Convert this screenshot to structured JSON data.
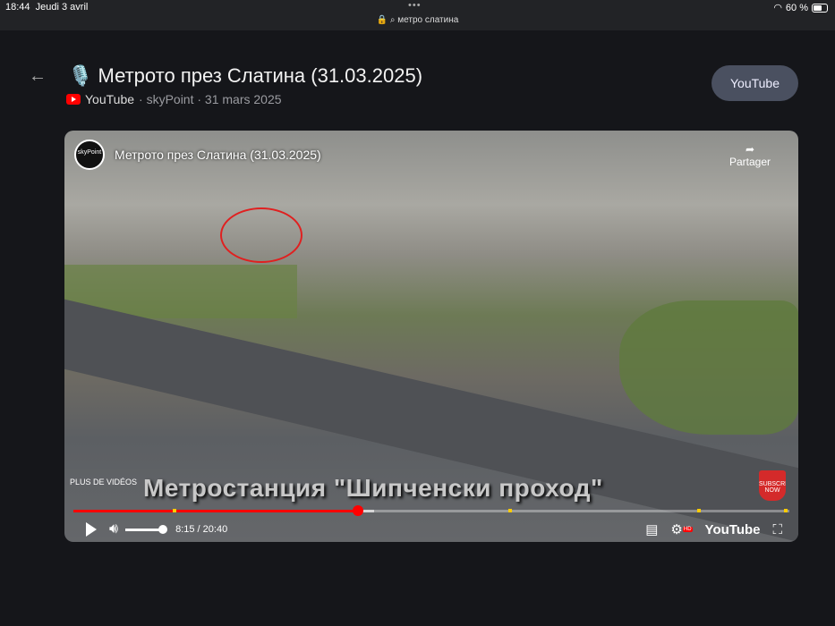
{
  "status_bar": {
    "time": "18:44",
    "date": "Jeudi 3 avril",
    "url": "метро слатина",
    "battery": "60 %",
    "dots": "•••"
  },
  "header": {
    "title": "🎙️ Метрото през Слатина (31.03.2025)",
    "source": "YouTube",
    "meta": "· skyPoint · 31 mars 2025",
    "open_button": "YouTube"
  },
  "video": {
    "channel_logo": "skyPoint",
    "title": "Метрото през Слатина (31.03.2025)",
    "share_label": "Partager",
    "more_videos": "PLUS DE VIDÉOS",
    "caption": "Метростанция \"Шипченски проход\"",
    "subscribe": "SUBSCRIBE NOW",
    "time": "8:15 / 20:40",
    "progress_percent": 39.8,
    "buffered_percent": 42,
    "volume_percent": 100,
    "youtube_label": "YouTube",
    "hd_badge": "HD"
  }
}
